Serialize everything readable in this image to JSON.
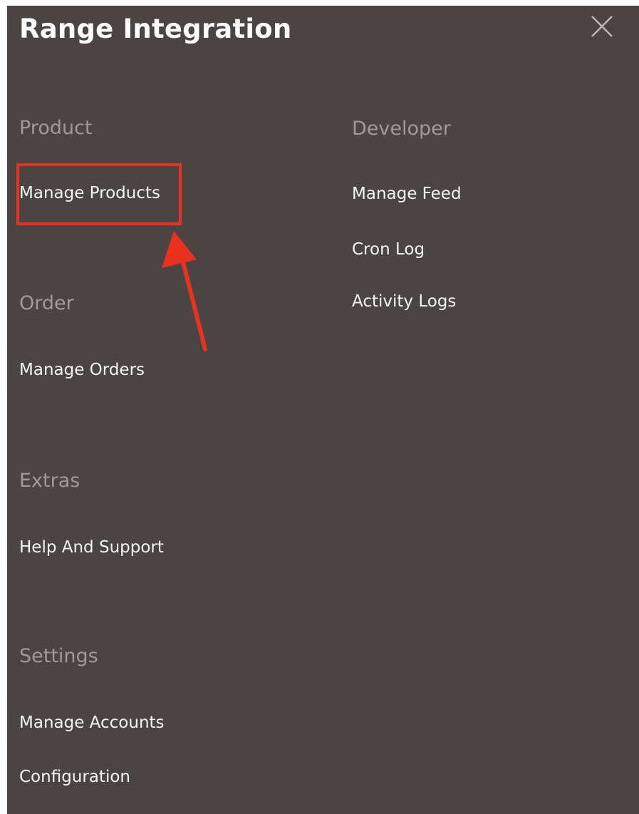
{
  "header": {
    "title": "Range Integration",
    "close_icon": "close-icon"
  },
  "sections": {
    "product": {
      "heading": "Product",
      "items": [
        "Manage Products"
      ]
    },
    "order": {
      "heading": "Order",
      "items": [
        "Manage Orders"
      ]
    },
    "extras": {
      "heading": "Extras",
      "items": [
        "Help And Support"
      ]
    },
    "settings": {
      "heading": "Settings",
      "items": [
        "Manage Accounts",
        "Configuration"
      ]
    },
    "developer": {
      "heading": "Developer",
      "items": [
        "Manage Feed",
        "Cron Log",
        "Activity Logs"
      ]
    }
  },
  "annotation": {
    "color": "#e8321e",
    "highlighted_item": "Manage Products"
  },
  "colors": {
    "panel_bg": "#4a4542",
    "heading": "#a09a96",
    "item": "#f4f4f4"
  }
}
